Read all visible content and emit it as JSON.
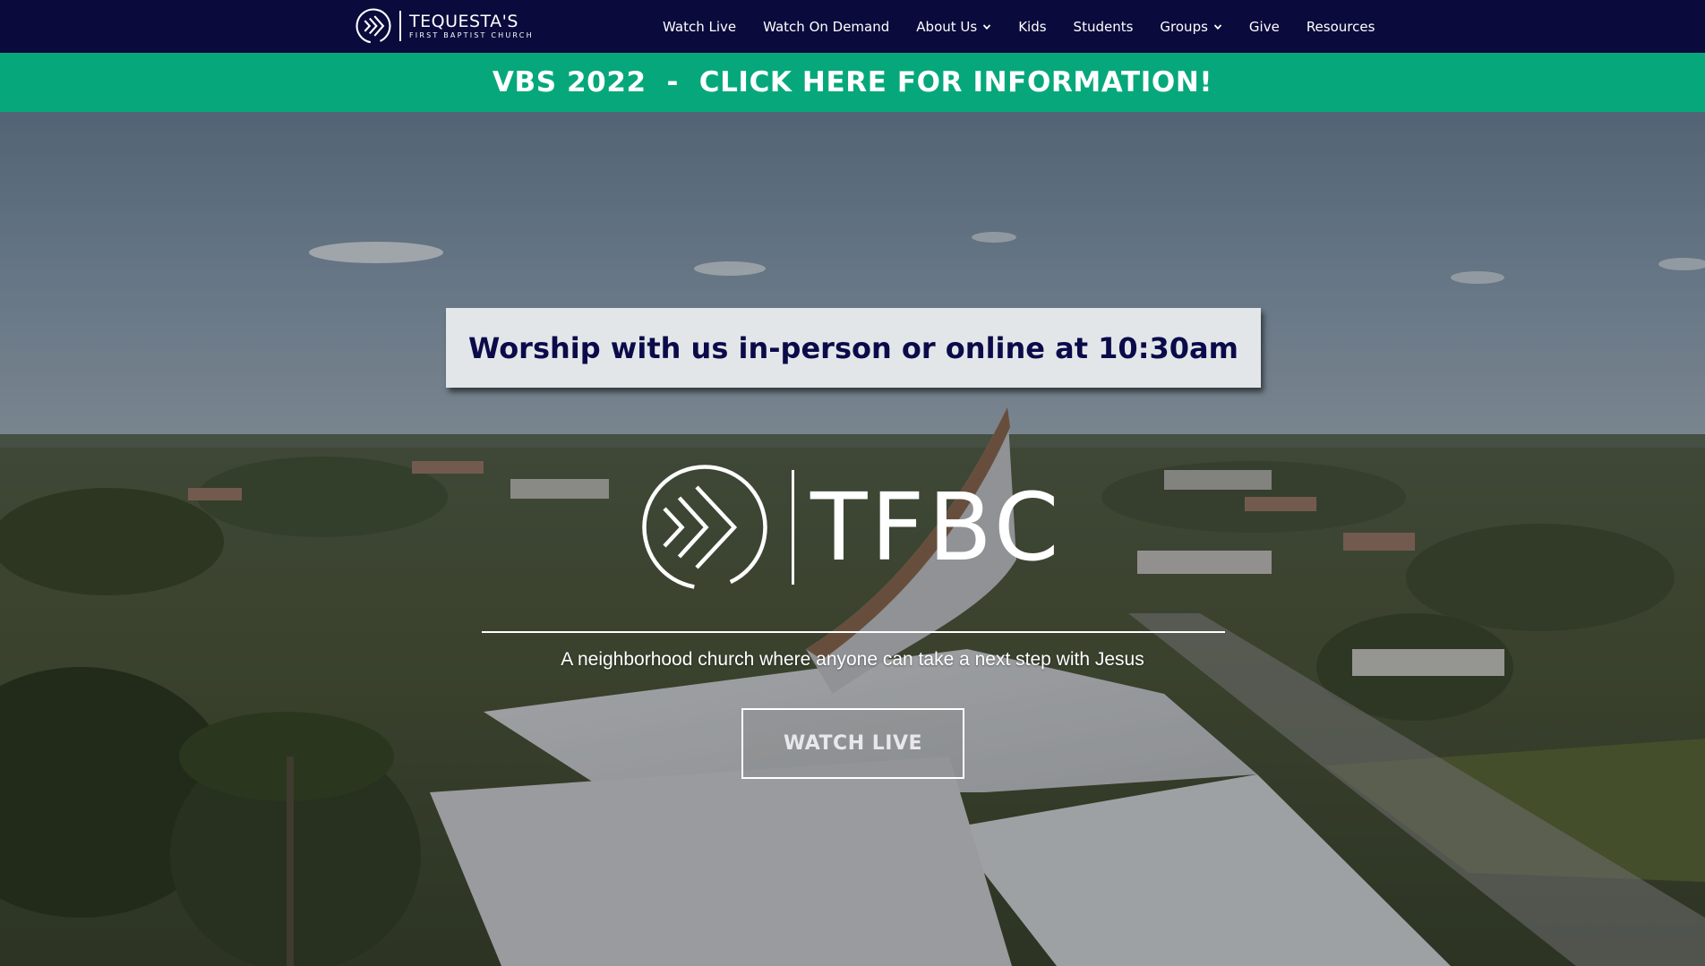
{
  "header": {
    "brand": {
      "name": "TEQUESTA'S",
      "subtitle": "FIRST BAPTIST CHURCH",
      "icon": "chevron-circle-logo-icon"
    },
    "nav": [
      {
        "label": "Watch Live",
        "has_dropdown": false
      },
      {
        "label": "Watch On Demand",
        "has_dropdown": false
      },
      {
        "label": "About Us",
        "has_dropdown": true
      },
      {
        "label": "Kids",
        "has_dropdown": false
      },
      {
        "label": "Students",
        "has_dropdown": false
      },
      {
        "label": "Groups",
        "has_dropdown": true
      },
      {
        "label": "Give",
        "has_dropdown": false
      },
      {
        "label": "Resources",
        "has_dropdown": false
      }
    ]
  },
  "announcement": {
    "text": "VBS 2022  -  CLICK HERE FOR INFORMATION!"
  },
  "hero": {
    "worship_text": "Worship with us in-person or online at 10:30am",
    "logo_text": "TFBC",
    "logo_icon": "chevron-circle-logo-icon",
    "tagline": "A neighborhood church where anyone can take a next step with Jesus",
    "cta_label": "WATCH LIVE",
    "background_image": "aerial-church-neighborhood-photo"
  },
  "colors": {
    "navbar_bg": "#0a0a3c",
    "announcement_bg": "#06a87b",
    "worship_box_bg": "#e3e6e9",
    "worship_text": "#0b0b4a",
    "white": "#ffffff"
  }
}
